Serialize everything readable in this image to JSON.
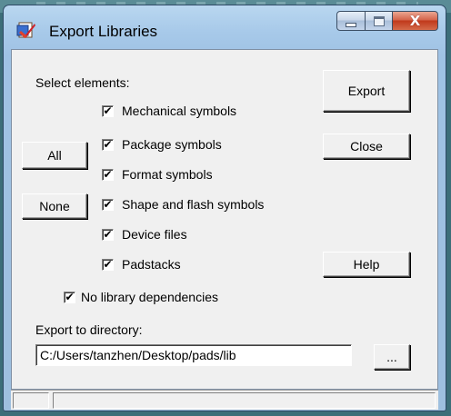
{
  "window": {
    "title": "Export Libraries"
  },
  "controls": {
    "close_glyph": "X"
  },
  "labels": {
    "select_elements": "Select elements:",
    "export_dir": "Export to directory:"
  },
  "buttons": {
    "export": "Export",
    "close": "Close",
    "help": "Help",
    "all": "All",
    "none": "None",
    "browse": "..."
  },
  "checkboxes": [
    {
      "label": "Mechanical symbols",
      "checked": true
    },
    {
      "label": "Package symbols",
      "checked": true
    },
    {
      "label": "Format symbols",
      "checked": true
    },
    {
      "label": "Shape and flash symbols",
      "checked": true
    },
    {
      "label": "Device files",
      "checked": true
    },
    {
      "label": "Padstacks",
      "checked": true
    }
  ],
  "no_dependencies": {
    "label": "No library dependencies",
    "checked": true
  },
  "directory": {
    "value": "C:/Users/tanzhen/Desktop/pads/lib"
  },
  "check_glyph": "✔",
  "colors": {
    "title_bar": "#a7c9e9",
    "close_button": "#c0391b",
    "dialog_bg": "#f0f0f0"
  }
}
